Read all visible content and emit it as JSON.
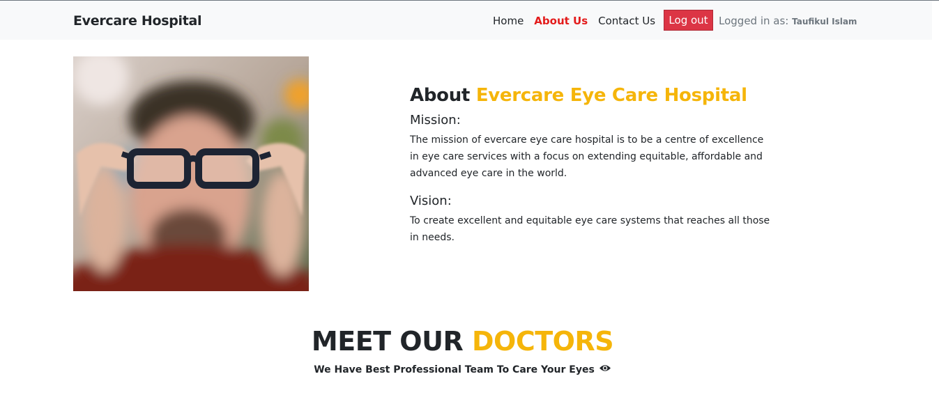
{
  "navbar": {
    "brand": "Evercare Hospital",
    "links": [
      "Home",
      "About Us",
      "Contact Us"
    ],
    "active": "About Us",
    "logout_label": "Log out",
    "logged_in_prefix": "Logged in as:",
    "user_name": "Taufikul Islam"
  },
  "about": {
    "title_prefix": "About",
    "title_accent": "Evercare Eye Care Hospital",
    "mission_heading": "Mission:",
    "mission_text": "The mission of evercare eye care hospital is to be a centre of excellence in eye care services with a focus on extending equitable, affordable and advanced eye care in the world.",
    "vision_heading": "Vision:",
    "vision_text": "To create excellent and equitable eye care systems that reaches all those in needs."
  },
  "meet": {
    "title_prefix": "MEET OUR",
    "title_accent": "DOCTORS",
    "subtitle": "We Have Best Professional Team To Care Your Eyes"
  },
  "colors": {
    "accent": "#f5b50a",
    "active_link": "#e31b1b",
    "logout_bg": "#dc3545"
  }
}
